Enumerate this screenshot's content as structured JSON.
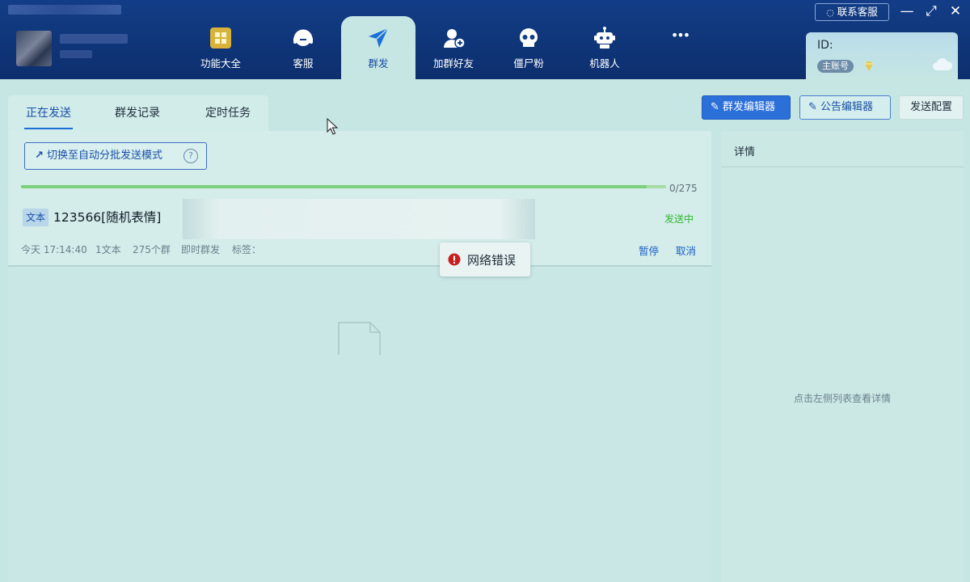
{
  "nav": {
    "items": [
      {
        "label": "功能大全",
        "icon": "grid-apps-icon"
      },
      {
        "label": "客服",
        "icon": "headset-icon"
      },
      {
        "label": "群发",
        "icon": "paper-plane-icon",
        "active": true
      },
      {
        "label": "加群好友",
        "icon": "add-user-icon"
      },
      {
        "label": "僵尸粉",
        "icon": "skull-icon"
      },
      {
        "label": "机器人",
        "icon": "robot-icon"
      },
      {
        "label": "•••",
        "icon": "more-icon"
      }
    ]
  },
  "window": {
    "contact_label": "联系客服",
    "minimize": "—",
    "maximize": "⤢",
    "close": "✕"
  },
  "account": {
    "id_label": "ID:",
    "badge": "主账号"
  },
  "tabs": [
    {
      "label": "正在发送",
      "active": true
    },
    {
      "label": "群发记录"
    },
    {
      "label": "定时任务"
    }
  ],
  "toolbar": {
    "mass_editor": "群发编辑器",
    "notice_editor": "公告编辑器",
    "send_config": "发送配置"
  },
  "task": {
    "mode_button": "切换至自动分批发送模式",
    "progress_text": "0/275",
    "progress_fraction": 0.97,
    "type_tag": "文本",
    "message": "123566[随机表情]",
    "status": "发送中",
    "time": "今天 17:14:40",
    "text_count": "1文本",
    "group_count": "275个群",
    "send_type": "即时群发",
    "tags_label": "标签：",
    "pause": "暂停",
    "cancel": "取消"
  },
  "toast": {
    "message": "网络错误"
  },
  "details": {
    "title": "详情",
    "empty_hint": "点击左侧列表查看详情"
  },
  "colors": {
    "nav_bg": "#0d2f6e",
    "accent": "#2b6fd9",
    "success": "#2fb82f",
    "error": "#c81e1e",
    "progress": "#7cd07a"
  }
}
